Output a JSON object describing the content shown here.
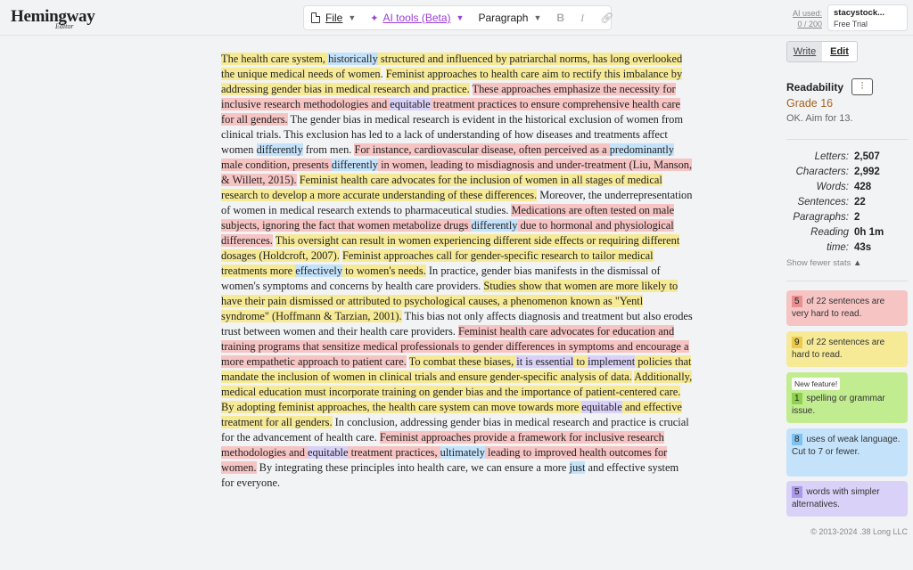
{
  "brand": {
    "name": "Hemingway",
    "sub": "Editor"
  },
  "toolbar": {
    "file_label": "File",
    "ai_label": "AI tools (Beta)",
    "paragraph_label": "Paragraph"
  },
  "usage": {
    "label": "AI used:",
    "value": "0 / 200"
  },
  "account": {
    "name": "stacystock...",
    "plan": "Free Trial"
  },
  "modes": {
    "write": "Write",
    "edit": "Edit"
  },
  "readability": {
    "title": "Readability",
    "grade": "Grade 16",
    "aim": "OK. Aim for 13."
  },
  "stats": [
    {
      "label": "Letters:",
      "value": "2,507"
    },
    {
      "label": "Characters:",
      "value": "2,992"
    },
    {
      "label": "Words:",
      "value": "428"
    },
    {
      "label": "Sentences:",
      "value": "22"
    },
    {
      "label": "Paragraphs:",
      "value": "2"
    },
    {
      "label": "Reading",
      "value": "0h 1m"
    },
    {
      "label": "time:",
      "value": "43s"
    }
  ],
  "show_fewer": "Show fewer stats",
  "cards": {
    "very_hard": {
      "num": "5",
      "text": "of 22 sentences are very hard to read."
    },
    "hard": {
      "num": "9",
      "text": "of 22 sentences are hard to read."
    },
    "spelling": {
      "badge": "New feature!",
      "num": "1",
      "text": "spelling or grammar issue."
    },
    "weak": {
      "num": "8",
      "text": "uses of weak language. Cut to 7 or fewer."
    },
    "simpler": {
      "num": "5",
      "text": "words with simpler alternatives."
    }
  },
  "copyright": "© 2013-2024 .38 Long LLC",
  "colors": {
    "very_hard": "#f7c4c4",
    "hard": "#f6ea97",
    "spelling": "#c2ec90",
    "weak": "#c4e3fb",
    "simpler": "#d9d1f7",
    "grade": "#a5621f",
    "ai": "#9b3fd6"
  },
  "document": [
    {
      "t": "The health care system, ",
      "c": "yellow"
    },
    {
      "t": "historically",
      "c": "blue"
    },
    {
      "t": " structured and influenced by patriarchal norms, has long overlooked the unique medical needs of women",
      "c": "yellow"
    },
    {
      "t": ". ",
      "c": ""
    },
    {
      "t": "Feminist approaches to health care aim to rectify this imbalance by addressing gender bias in medical research and practice.",
      "c": "yellow"
    },
    {
      "t": " ",
      "c": ""
    },
    {
      "t": "These approaches emphasize the necessity for inclusive research methodologies and ",
      "c": "red"
    },
    {
      "t": "equitable",
      "c": "purple"
    },
    {
      "t": " treatment practices to ensure comprehensive health care for all genders.",
      "c": "red"
    },
    {
      "t": " The gender bias in medical research is evident in the historical exclusion of women from clinical trials. This exclusion has led to a lack of understanding of how diseases and treatments affect women ",
      "c": ""
    },
    {
      "t": "differently",
      "c": "blue"
    },
    {
      "t": " from men. ",
      "c": ""
    },
    {
      "t": "For instance, cardiovascular disease, often perceived as a ",
      "c": "red"
    },
    {
      "t": "predominantly",
      "c": "blue"
    },
    {
      "t": " male condition, presents ",
      "c": "red"
    },
    {
      "t": "differently",
      "c": "blue"
    },
    {
      "t": " in women, leading to misdiagnosis and under-treatment (Liu, Manson, & Willett, 2015).",
      "c": "red"
    },
    {
      "t": " ",
      "c": ""
    },
    {
      "t": "Feminist health care advocates for the inclusion of women in all stages of medical research to develop a more accurate understanding of these differences.",
      "c": "yellow"
    },
    {
      "t": " Moreover, the underrepresentation of women in medical research extends to pharmaceutical studies. ",
      "c": ""
    },
    {
      "t": "Medications are often tested on male subjects, ignoring the fact that women metabolize drugs ",
      "c": "red"
    },
    {
      "t": "differently",
      "c": "blue"
    },
    {
      "t": " due to hormonal and physiological differences.",
      "c": "red"
    },
    {
      "t": " ",
      "c": ""
    },
    {
      "t": "This oversight can result in women experiencing different side effects or requiring different dosages (Holdcroft, 2007).",
      "c": "yellow"
    },
    {
      "t": " ",
      "c": ""
    },
    {
      "t": "Feminist approaches call for gender-specific research to tailor medical treatments more ",
      "c": "yellow"
    },
    {
      "t": "effectively",
      "c": "blue"
    },
    {
      "t": " to women's needs.",
      "c": "yellow"
    },
    {
      "t": " In practice, gender bias manifests in the dismissal of women's symptoms and concerns by health care providers. ",
      "c": ""
    },
    {
      "t": "Studies show that women are more likely to have their pain dismissed or attributed to psychological causes, a phenomenon known as \"Yentl syndrome\" (Hoffmann & Tarzian, 2001).",
      "c": "yellow"
    },
    {
      "t": " This bias not only affects diagnosis and treatment but also erodes trust between women and their health care providers. ",
      "c": ""
    },
    {
      "t": "Feminist health care advocates for education and training programs that sensitize medical professionals to gender differences in symptoms and encourage a more empathetic approach to patient care.",
      "c": "red"
    },
    {
      "t": " ",
      "c": ""
    },
    {
      "t": "To combat these biases, ",
      "c": "yellow"
    },
    {
      "t": "it is essential",
      "c": "purple"
    },
    {
      "t": " to ",
      "c": "yellow"
    },
    {
      "t": "implement",
      "c": "purple"
    },
    {
      "t": " policies that mandate the inclusion of women in clinical trials and ensure gender-specific analysis of data.",
      "c": "yellow"
    },
    {
      "t": " ",
      "c": ""
    },
    {
      "t": "Additionally, medical education must incorporate training on gender bias and the importance of patient-centered care.",
      "c": "yellow"
    },
    {
      "t": " ",
      "c": ""
    },
    {
      "t": "By adopting feminist approaches, the health care system can move towards more ",
      "c": "yellow"
    },
    {
      "t": "equitable",
      "c": "purple"
    },
    {
      "t": " and effective treatment for all genders.",
      "c": "yellow"
    },
    {
      "t": " In conclusion, addressing gender bias in medical research and practice is crucial for the advancement of health care. ",
      "c": ""
    },
    {
      "t": "Feminist approaches provide a framework for inclusive research methodologies and ",
      "c": "red"
    },
    {
      "t": "equitable",
      "c": "purple"
    },
    {
      "t": " treatment practices, ",
      "c": "red"
    },
    {
      "t": "ultimately",
      "c": "blue"
    },
    {
      "t": " leading to improved health outcomes for women.",
      "c": "red"
    },
    {
      "t": " By integrating these principles into health care, we can ensure a more ",
      "c": ""
    },
    {
      "t": "just",
      "c": "blue"
    },
    {
      "t": " and effective system for everyone.",
      "c": ""
    }
  ]
}
